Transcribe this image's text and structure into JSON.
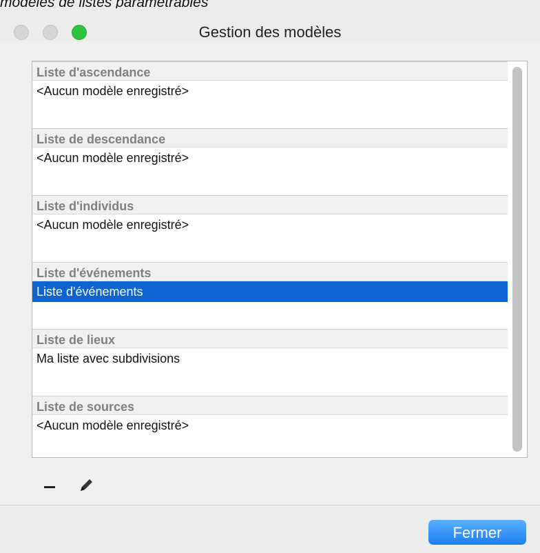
{
  "caption": "modèles de listes paramétrables",
  "window": {
    "title": "Gestion des modèles"
  },
  "sections": [
    {
      "header": "Liste d'ascendance",
      "row": "<Aucun modèle enregistré>",
      "selected": false
    },
    {
      "header": "Liste de descendance",
      "row": "<Aucun modèle enregistré>",
      "selected": false
    },
    {
      "header": "Liste d'individus",
      "row": "<Aucun modèle enregistré>",
      "selected": false
    },
    {
      "header": "Liste d'événements",
      "row": "Liste d'événements",
      "selected": true
    },
    {
      "header": "Liste de lieux",
      "row": "Ma liste avec subdivisions",
      "selected": false
    },
    {
      "header": "Liste de sources",
      "row": "<Aucun modèle enregistré>",
      "selected": false
    }
  ],
  "toolbar": {
    "remove_icon": "minus-icon",
    "edit_icon": "pencil-icon"
  },
  "footer": {
    "close_label": "Fermer"
  },
  "colors": {
    "selection": "#0b64d0",
    "primary_button": "#1b7ff0",
    "zoom_light": "#2fc13f"
  }
}
